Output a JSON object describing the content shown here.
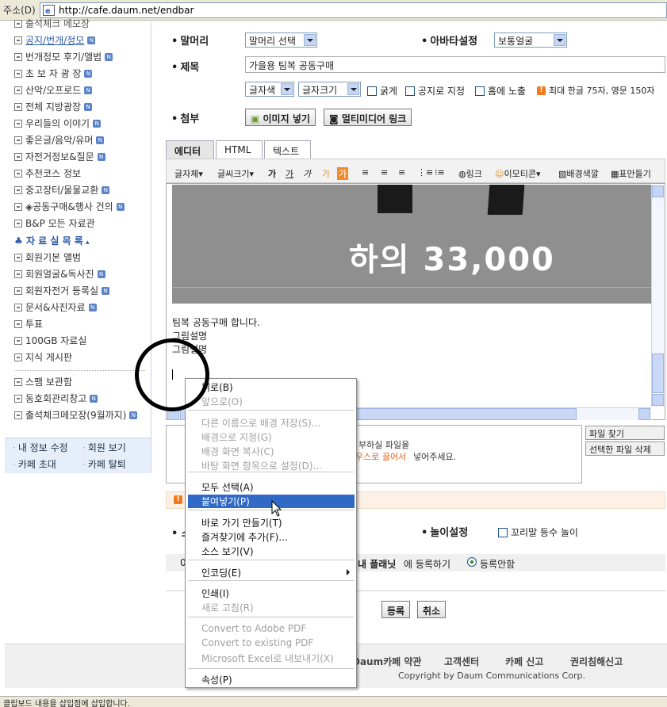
{
  "address": {
    "label": "주소(D)",
    "url": "http://cafe.daum.net/endbar"
  },
  "sidebar": {
    "items": [
      {
        "label": "공지/번개/정모",
        "link": true,
        "badge": "N"
      },
      {
        "label": "번개정모 후기/앨범",
        "badge": "N"
      },
      {
        "label": "초 보 자 광 장",
        "badge": "N"
      },
      {
        "label": "산악/오프로드",
        "badge": "N"
      },
      {
        "label": "전체 지방광장",
        "badge": "N"
      },
      {
        "label": "우리들의 이야기",
        "badge": "N"
      },
      {
        "label": "좋은글/음악/유머",
        "badge": "N"
      },
      {
        "label": "자전거정보&질문",
        "badge": "N"
      },
      {
        "label": "추천코스 정보",
        "badge": ""
      },
      {
        "label": "중고장터/물물교환",
        "badge": "N"
      },
      {
        "label": "◈공동구매&행사 건의",
        "badge": "N"
      },
      {
        "label": "B&P 모든 자료관",
        "badge": ""
      }
    ],
    "section_heading": "자 료 실 목 록",
    "section_items": [
      {
        "label": "회원기본 앨범",
        "badge": ""
      },
      {
        "label": "회원얼굴&독사진",
        "badge": "N"
      },
      {
        "label": "회원자전거 등록실",
        "badge": "N"
      },
      {
        "label": "문서&사진자료",
        "badge": "N"
      },
      {
        "label": "투표",
        "badge": ""
      },
      {
        "label": "100GB 자료실",
        "badge": ""
      },
      {
        "label": "지식 게시판",
        "badge": ""
      }
    ],
    "extra_items": [
      {
        "label": "스팸 보관함",
        "badge": ""
      },
      {
        "label": "동호회관리창고",
        "badge": "N"
      },
      {
        "label": "출석체크메모장(9월까지)",
        "badge": "N"
      }
    ],
    "bottom_links": [
      "내 정보 수정",
      "회원 보기",
      "카페 초대",
      "카페 탈퇴"
    ]
  },
  "form": {
    "header_label": "말머리",
    "header_select": "말머리 선택",
    "avatar_label": "아바타설정",
    "avatar_select": "보통얼굴",
    "title_label": "제목",
    "title_value": "가을용 팀복 공동구매",
    "font_color": "글자색",
    "font_size": "글자크기",
    "bold_label": "굵게",
    "notice_label": "공지로 지정",
    "home_label": "홈에 노출",
    "limit_text": "최대 한글 75자, 영문 150자",
    "attach_label": "첨부",
    "image_button": "이미지 넣기",
    "media_button": "멀티미디어 링크",
    "tabs": [
      "에디터",
      "HTML",
      "텍스트"
    ],
    "toolbar": {
      "font_face": "글자체▾",
      "font_size": "글씨크기▾",
      "link": "링크",
      "emoticon": "이모티콘▾",
      "bgcolor": "배경색깔",
      "table": "표만들기"
    },
    "banner_text": "하의 33,000",
    "editor_lines": [
      "팀복 공동구매 합니다.",
      "그림설명",
      "그림설명"
    ],
    "upload_text_1": "부하실 파일을",
    "upload_text_2": "우스로 끌어서",
    "upload_text_3": "넣어주세요.",
    "find_file": "파일 찾기",
    "delete_file": "선택한 파일 삭제",
    "play_label": "놀이설정",
    "play_check": "꼬리말 등수 놀이",
    "planet_bold": "내 플래닛",
    "planet_text": "에 등록하기",
    "planet_radio": "등록안함",
    "submit": "등록",
    "cancel": "취소",
    "row_prefix": "0",
    "play_left_char": "스"
  },
  "footer": {
    "links": [
      "Daum카페 약관",
      "고객센터",
      "카페 신고",
      "권리침해신고"
    ],
    "copyright": "Copyright by Daum Communications Corp."
  },
  "status_text": "클립보드 내용을 삽입점에 삽입합니다.",
  "context_menu": {
    "items": [
      {
        "label": "뒤로(B)",
        "disabled": false
      },
      {
        "label": "앞으로(O)",
        "disabled": true
      },
      {
        "label": "다른 이름으로 배경 저장(S)...",
        "disabled": true
      },
      {
        "label": "배경으로 지정(G)",
        "disabled": true
      },
      {
        "label": "배경 화면 복사(C)",
        "disabled": true
      },
      {
        "label": "바탕 화면 항목으로 설정(D)...",
        "disabled": true
      },
      {
        "label": "모두 선택(A)",
        "disabled": false
      },
      {
        "label": "붙여넣기(P)",
        "disabled": false,
        "highlighted": true
      },
      {
        "label": "바로 가기 만들기(T)",
        "disabled": false
      },
      {
        "label": "즐겨찾기에 추가(F)...",
        "disabled": false
      },
      {
        "label": "소스 보기(V)",
        "disabled": false
      },
      {
        "label": "인코딩(E)",
        "disabled": false,
        "submenu": true
      },
      {
        "label": "인쇄(I)",
        "disabled": false
      },
      {
        "label": "새로 고침(R)",
        "disabled": true
      },
      {
        "label": "Convert to Adobe PDF",
        "disabled": true
      },
      {
        "label": "Convert to existing PDF",
        "disabled": true
      },
      {
        "label": "Microsoft Excel로 내보내기(X)",
        "disabled": true
      },
      {
        "label": "속성(P)",
        "disabled": false
      }
    ]
  },
  "colors": {
    "highlight": "#316ac5",
    "accent": "#2b5aa8",
    "warn": "#f07a1c",
    "banner": "#8f8f8f"
  }
}
